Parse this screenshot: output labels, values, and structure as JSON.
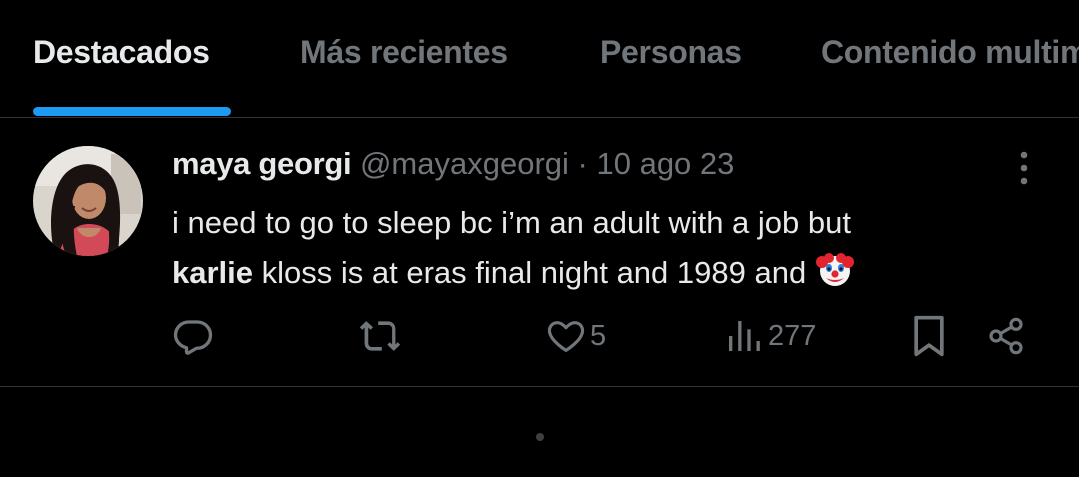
{
  "tabs": [
    {
      "label": "Destacados",
      "active": true
    },
    {
      "label": "Más recientes",
      "active": false
    },
    {
      "label": "Personas",
      "active": false
    },
    {
      "label": "Contenido multimedia",
      "active": false
    }
  ],
  "tweet": {
    "author_name": "maya georgi",
    "handle": "@mayaxgeorgi",
    "separator": "·",
    "date": "10 ago 23",
    "text_line1": "i need to go to sleep bc i’m an adult with a job but",
    "text_bold": "karlie",
    "text_line2_rest": " kloss is at eras final night and 1989 and ",
    "emoji": "clown-face-emoji",
    "actions": {
      "reply_icon": "reply-icon",
      "retweet_icon": "retweet-icon",
      "like_icon": "heart-icon",
      "like_count": "5",
      "views_icon": "views-chart-icon",
      "views_count": "277",
      "bookmark_icon": "bookmark-icon",
      "share_icon": "share-icon"
    }
  },
  "colors": {
    "background": "#000000",
    "primary_text": "#e7e9ea",
    "secondary_text": "#71767b",
    "accent": "#1d9bf0",
    "divider": "#2f3336"
  }
}
